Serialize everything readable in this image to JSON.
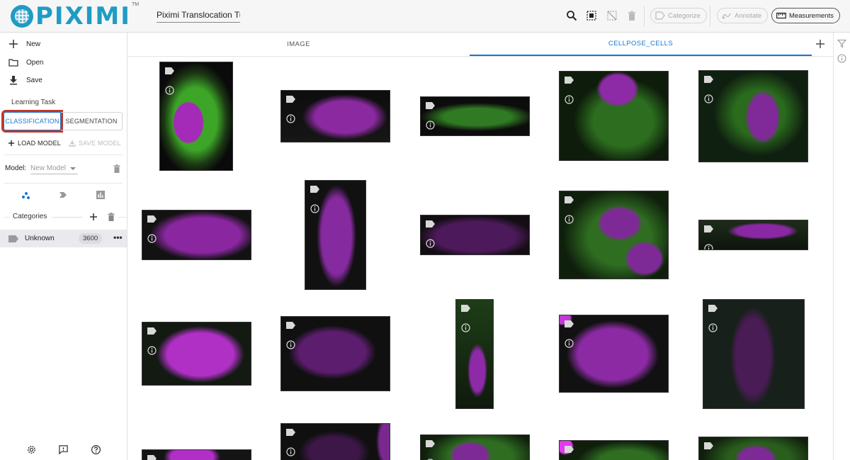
{
  "app": {
    "logo_text": "PIXIMI",
    "logo_tm": "TM",
    "project_name": "Piximi Translocation Tu"
  },
  "toolbar": {
    "categorize_label": "Categorize",
    "annotate_label": "Annotate",
    "measurements_label": "Measurements"
  },
  "sidebar": {
    "new_label": "New",
    "open_label": "Open",
    "save_label": "Save",
    "learning_task_label": "Learning Task",
    "classification_label": "CLASSIFICATION",
    "segmentation_label": "SEGMENTATION",
    "load_model_label": "LOAD MODEL",
    "save_model_label": "SAVE MODEL",
    "model_label": "Model:",
    "model_value": "New Model",
    "categories_label": "Categories",
    "categories": [
      {
        "name": "Unknown",
        "count": "3600"
      }
    ]
  },
  "tabs": [
    {
      "label": "IMAGE",
      "active": false
    },
    {
      "label": "CELLPOSE_CELLS",
      "active": true
    }
  ],
  "colors": {
    "accent": "#1976d2",
    "logo": "#1f9cc4",
    "highlight": "#c0392b",
    "green_channel": "#3c9a2a",
    "magenta_channel": "#b02cc0"
  },
  "grid": {
    "icon_names": [
      "label-icon",
      "info-icon"
    ]
  }
}
